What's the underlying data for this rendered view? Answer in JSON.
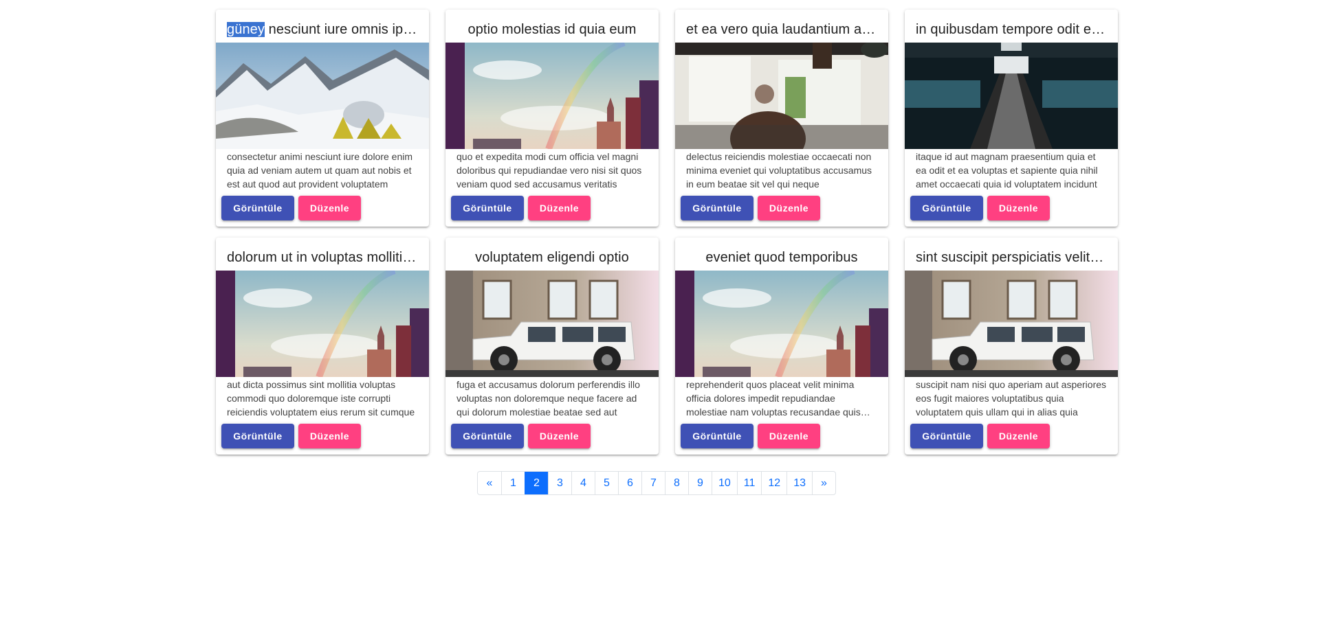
{
  "cards": [
    {
      "title_highlight": "güney",
      "title": " nesciunt iure omnis ipsum",
      "align": "left",
      "image": "snowy-mountain-camp",
      "text": "consectetur animi nesciunt iure dolore enim quia ad veniam autem ut quam aut nobis et est aut quod aut provident voluptatem"
    },
    {
      "title": "optio molestias id quia eum",
      "align": "center",
      "image": "city-rainbow",
      "text": "quo et expedita modi cum officia vel magni doloribus qui repudiandae vero nisi sit quos veniam quod sed accusamus veritatis"
    },
    {
      "title": "et ea vero quia laudantium autem",
      "align": "left",
      "image": "cafe-man",
      "text": "delectus reiciendis molestiae occaecati non minima eveniet qui voluptatibus accusamus in eum beatae sit vel qui neque"
    },
    {
      "title": "in quibusdam tempore odit est dolorem",
      "align": "left",
      "image": "escalator-station",
      "text": "itaque id aut magnam praesentium quia et ea odit et ea voluptas et sapiente quia nihil amet occaecati quia id voluptatem incidunt"
    },
    {
      "title": "dolorum ut in voluptas mollitia et",
      "align": "left",
      "image": "city-rainbow",
      "text": "aut dicta possimus sint mollitia voluptas commodi quo doloremque iste corrupti reiciendis voluptatem eius rerum sit cumque"
    },
    {
      "title": "voluptatem eligendi optio",
      "align": "center",
      "image": "white-jeep",
      "text": "fuga et accusamus dolorum perferendis illo voluptas non doloremque neque facere ad qui dolorum molestiae beatae sed aut"
    },
    {
      "title": "eveniet quod temporibus",
      "align": "center",
      "image": "city-rainbow",
      "text": "reprehenderit quos placeat velit minima officia dolores impedit repudiandae molestiae nam voluptas recusandae quis delectus"
    },
    {
      "title": "sint suscipit perspiciatis velit dolorum",
      "align": "left",
      "image": "white-jeep",
      "text": "suscipit nam nisi quo aperiam aut asperiores eos fugit maiores voluptatibus quia voluptatem quis ullam qui in alias quia"
    }
  ],
  "buttons": {
    "view": "Görüntüle",
    "edit": "Düzenle"
  },
  "pagination": {
    "prev": "«",
    "next": "»",
    "pages": [
      "1",
      "2",
      "3",
      "4",
      "5",
      "6",
      "7",
      "8",
      "9",
      "10",
      "11",
      "12",
      "13"
    ],
    "active": "2"
  },
  "colors": {
    "view_button": "#3f51b5",
    "edit_button": "#ff4081",
    "active_page": "#0d6efd",
    "selection": "#3a73d1"
  }
}
